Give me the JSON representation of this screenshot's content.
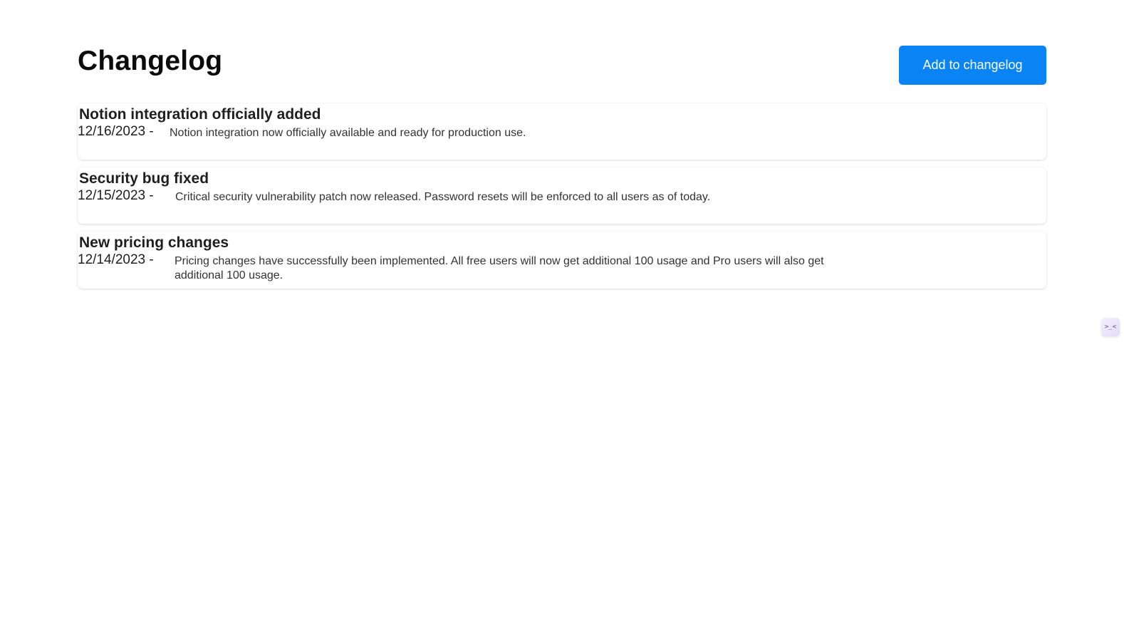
{
  "page": {
    "title": "Changelog",
    "add_button_label": "Add to changelog"
  },
  "colors": {
    "accent": "#0a84f5",
    "background": "#ffffff",
    "text": "#1a1a1a"
  },
  "entries": [
    {
      "title": "Notion integration officially added",
      "date": "12/16/2023 -",
      "description": "Notion integration now officially available and ready for production use."
    },
    {
      "title": "Security bug fixed",
      "date": "12/15/2023 -",
      "description": "Critical security vulnerability patch now released. Password resets will be enforced to all users as of today."
    },
    {
      "title": "New pricing changes",
      "date": "12/14/2023 -",
      "description": "Pricing changes have successfully been implemented. All free users will now get additional 100 usage and Pro users will also get additional 100 usage."
    }
  ],
  "widget": {
    "icon": "terminal-face-icon",
    "glyph": ">_<"
  }
}
